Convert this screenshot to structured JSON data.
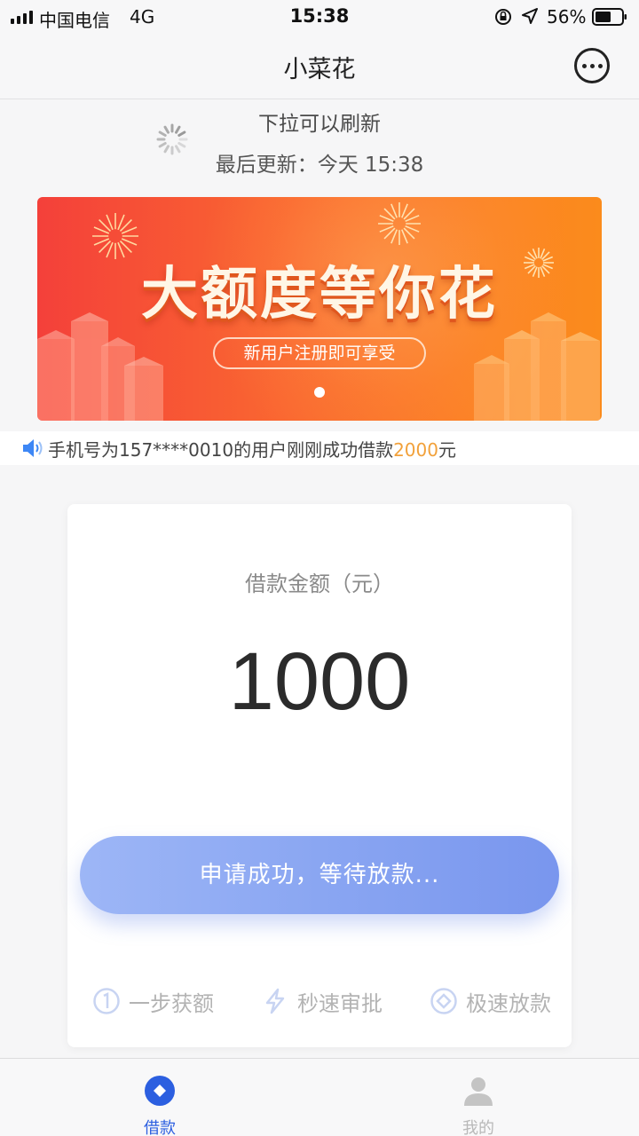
{
  "status_bar": {
    "carrier": "中国电信",
    "network": "4G",
    "time": "15:38",
    "battery": "56%"
  },
  "nav": {
    "title": "小菜花",
    "more_icon": "more-dots-icon"
  },
  "refresh": {
    "pull_text": "下拉可以刷新",
    "last_update": "最后更新：今天 15:38"
  },
  "banner": {
    "title": "大额度等你花",
    "subtitle": "新用户注册即可享受",
    "colors": {
      "start": "#f4403a",
      "end": "#fb8b1c"
    }
  },
  "notice": {
    "text_before": "手机号为157****0010的用户刚刚成功借款",
    "amount": "2000",
    "text_after": "元",
    "amount_color": "#f2a13a"
  },
  "loan": {
    "amount_label": "借款金额（元）",
    "amount": "1000",
    "button_label": "申请成功，等待放款..."
  },
  "features": [
    {
      "icon": "one-circle-icon",
      "label": "一步获额"
    },
    {
      "icon": "lightning-icon",
      "label": "秒速审批"
    },
    {
      "icon": "diamond-circle-icon",
      "label": "极速放款"
    }
  ],
  "tabs": [
    {
      "label": "借款",
      "icon": "loan-diamond-icon",
      "active": true
    },
    {
      "label": "我的",
      "icon": "user-icon",
      "active": false
    }
  ],
  "colors": {
    "accent": "#2c5fe0",
    "button": "#8aa6f2",
    "inactive": "#b8b8b8"
  }
}
